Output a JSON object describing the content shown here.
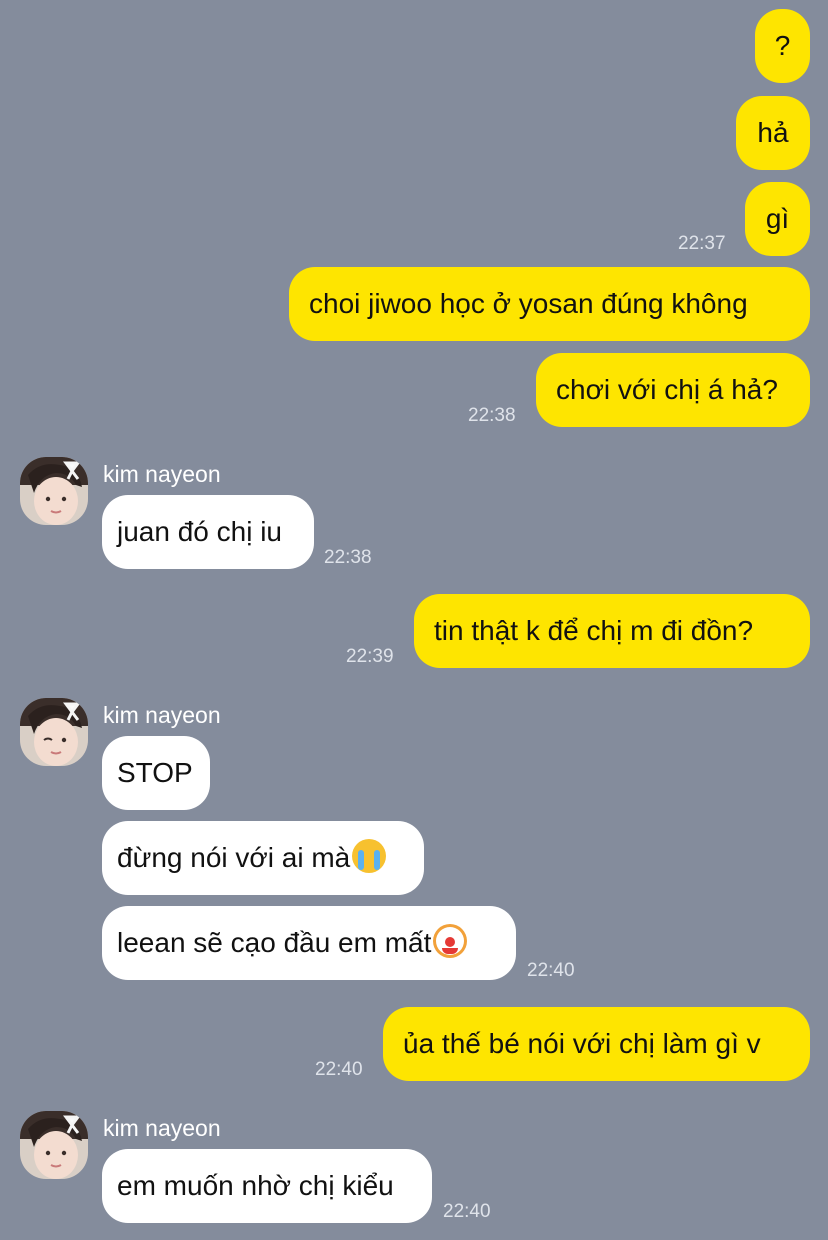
{
  "chat": {
    "contact_name": "kim nayeon",
    "outgoing_1": "?",
    "outgoing_2": "hả",
    "outgoing_3": "gì",
    "time_1": "22:37",
    "outgoing_4": "choi jiwoo học ở yosan đúng không",
    "outgoing_5": "chơi với chị á hả?",
    "time_2": "22:38",
    "incoming_1": "juan đó chị iu",
    "time_3": "22:38",
    "outgoing_6": "tin thật k để chị m đi đồn?",
    "time_4": "22:39",
    "incoming_2": "STOP",
    "incoming_3": "đừng nói với ai mà",
    "incoming_3_emoji": "loudly-crying-face-emoji",
    "incoming_4": "leean sẽ cạo đầu em mất",
    "incoming_4_emoji": "clown-face-emoji",
    "time_5": "22:40",
    "outgoing_7": "ủa thế bé nói với chị làm gì v",
    "time_6": "22:40",
    "incoming_5": "em muốn nhờ chị kiểu",
    "time_7": "22:40"
  },
  "colors": {
    "background": "#848c9c",
    "outgoing_bubble": "#fee500",
    "incoming_bubble": "#ffffff"
  }
}
